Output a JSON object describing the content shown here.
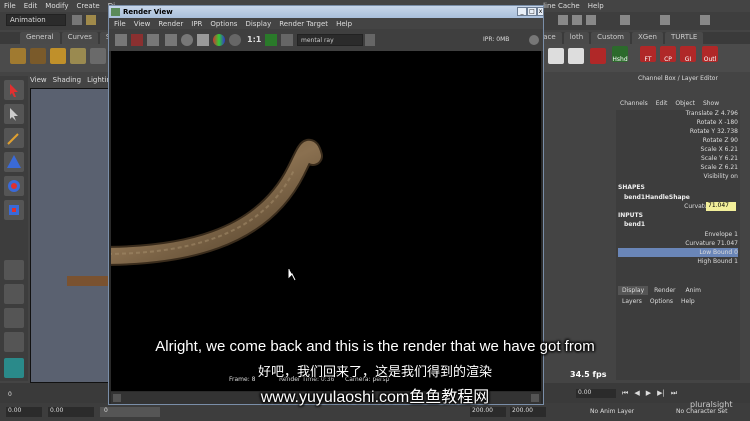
{
  "menubar": [
    "File",
    "Edit",
    "Modify",
    "Create",
    "Di"
  ],
  "menubar_right": [
    "line Cache",
    "Help"
  ],
  "mode": "Animation",
  "shelf_tabs": [
    "General",
    "Curves",
    "Su"
  ],
  "shelf_tabs_right": [
    "Custom",
    "XGen",
    "TURTLE"
  ],
  "shelf_tab_left_partial": "face",
  "shelf_tab_left_partial2": "loth",
  "shelf_labels": [
    "Hshd",
    "FT",
    "CP",
    "GI",
    "Outl"
  ],
  "viewport_menu": [
    "View",
    "Shading",
    "Lighting"
  ],
  "render_view": {
    "title": "Render View",
    "menu": [
      "File",
      "View",
      "Render",
      "IPR",
      "Options",
      "Display",
      "Render Target",
      "Help"
    ],
    "ratio": "1:1",
    "renderer": "mental ray",
    "ipr": "IPR: 0MB",
    "frame_info": "Frame: 8",
    "render_time": "Render Time: 0:36",
    "camera": "Camera: persp",
    "size_partial": "2 x 6"
  },
  "channel_box": {
    "title": "Channel Box / Layer Editor",
    "menu": [
      "Channels",
      "Edit",
      "Object",
      "Show"
    ],
    "rows": [
      {
        "label": "Translate Z",
        "value": "4.796"
      },
      {
        "label": "Rotate X",
        "value": "-180"
      },
      {
        "label": "Rotate Y",
        "value": "32.738"
      },
      {
        "label": "Rotate Z",
        "value": "90"
      },
      {
        "label": "Scale X",
        "value": "6.21"
      },
      {
        "label": "Scale Y",
        "value": "6.21"
      },
      {
        "label": "Scale Z",
        "value": "6.21"
      },
      {
        "label": "Visibility",
        "value": "on"
      }
    ],
    "shapes_header": "SHAPES",
    "shape_name": "bend1HandleShape",
    "curvature_label": "Curvature",
    "curvature_value": "71.047",
    "inputs_header": "INPUTS",
    "input_name": "bend1",
    "input_rows": [
      {
        "label": "Envelope",
        "value": "1"
      },
      {
        "label": "Curvature",
        "value": "71.047"
      },
      {
        "label": "Low Bound",
        "value": "0"
      },
      {
        "label": "High Bound",
        "value": "1"
      }
    ],
    "layer_tabs": [
      "Display",
      "Render",
      "Anim"
    ],
    "layer_menu": [
      "Layers",
      "Options",
      "Help"
    ]
  },
  "fps": "34.5 fps",
  "timeline": {
    "start": "0",
    "range_start": "0.00",
    "range_start2": "0.00",
    "current": "0",
    "end1": "200.00",
    "end2": "200.00",
    "current_frame": "0.00",
    "anim_layer": "No Anim Layer",
    "char_set": "No Character Set"
  },
  "subtitle_en": "Alright, we come back and this is the render that we have got from",
  "subtitle_cn": "好吧，我们回来了，这是我们得到的渲染",
  "watermark": "www.yuyulaoshi.com鱼鱼教程网",
  "brand": "pluralsight",
  "colors": {
    "accent_yellow": "#f2ef9a",
    "highlight_blue": "#6a86b8"
  }
}
